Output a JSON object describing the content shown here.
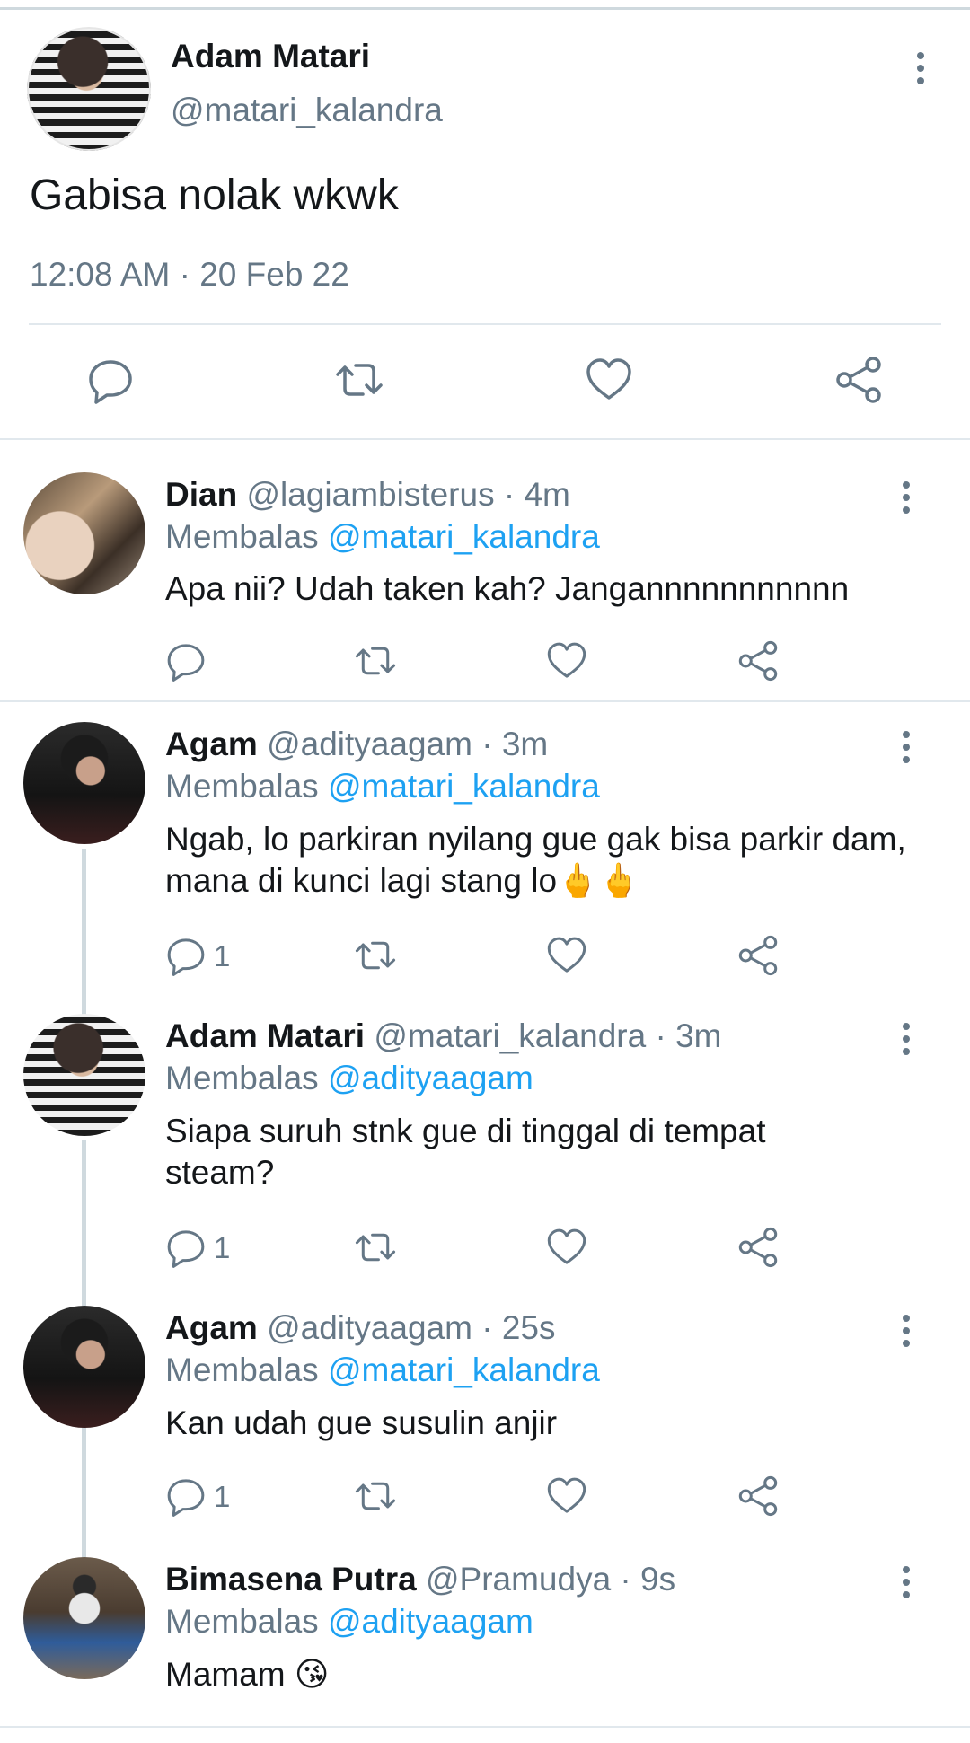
{
  "main_tweet": {
    "name": "Adam Matari",
    "handle": "@matari_kalandra",
    "text": "Gabisa nolak wkwk",
    "timestamp": "12:08 AM · 20 Feb 22"
  },
  "replies": [
    {
      "name": "Dian",
      "handle": "@lagiambisterus",
      "time": " · 4m",
      "replying_label": "Membalas ",
      "replying_to": "@matari_kalandra",
      "text": "Apa nii? Udah taken kah? Jangannnnnnnnnnn",
      "reply_count": ""
    },
    {
      "name": "Agam",
      "handle": "@adityaagam",
      "time": " · 3m",
      "replying_label": "Membalas ",
      "replying_to": "@matari_kalandra",
      "text": "Ngab, lo parkiran nyilang gue gak bisa parkir dam, mana di kunci lagi stang lo",
      "emoji": "🖕🖕",
      "reply_count": "1"
    },
    {
      "name": "Adam Matari",
      "handle": "@matari_kalandra",
      "time": " · 3m",
      "replying_label": "Membalas ",
      "replying_to": "@adityaagam",
      "text": "Siapa suruh stnk gue di tinggal di tempat steam?",
      "reply_count": "1"
    },
    {
      "name": "Agam",
      "handle": "@adityaagam",
      "time": " · 25s",
      "replying_label": "Membalas ",
      "replying_to": "@matari_kalandra",
      "text": "Kan udah gue susulin anjir",
      "reply_count": "1"
    },
    {
      "name": "Bimasena Putra",
      "handle": "@Pramudya",
      "time": " · 9s",
      "replying_label": "Membalas ",
      "replying_to": "@adityaagam",
      "text": "Mamam",
      "emoji": "😘"
    }
  ],
  "icons": {
    "reply": "reply-icon",
    "retweet": "retweet-icon",
    "like": "like-icon",
    "share": "share-icon",
    "more": "more-options-icon"
  },
  "colors": {
    "accent": "#1da1f2",
    "secondary_text": "#657786",
    "primary_text": "#14171a",
    "divider": "#e1e8ed"
  }
}
